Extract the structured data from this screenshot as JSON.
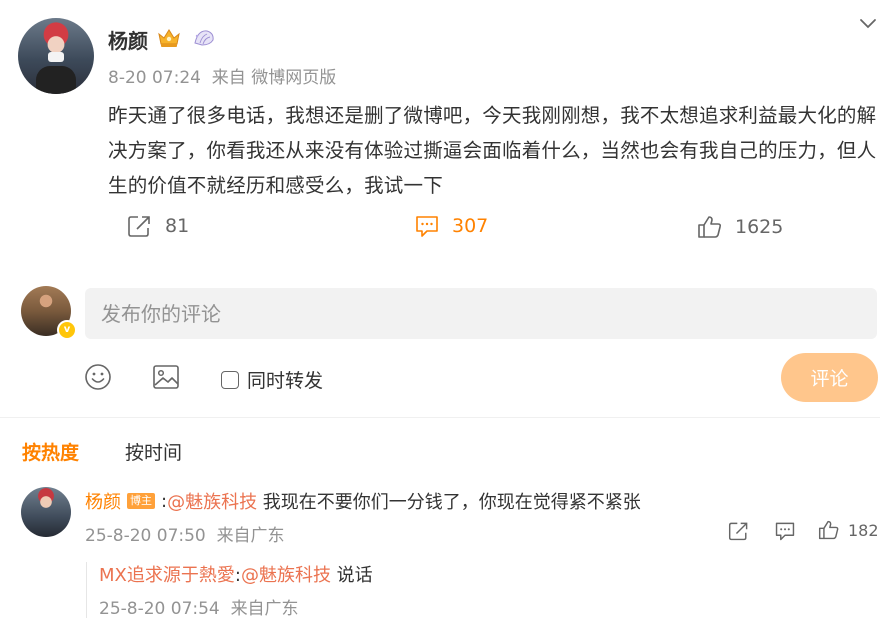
{
  "post": {
    "author": "杨颜",
    "date": "8-20 07:24",
    "source": "来自 微博网页版",
    "text": "昨天通了很多电话，我想还是删了微博吧，今天我刚刚想，我不太想追求利益最大化的解决方案了，你看我还从来没有体验过撕逼会面临着什么，当然也会有我自己的压力，但人生的价值不就经历和感受么，我试一下",
    "reposts": "81",
    "comments": "307",
    "likes": "1625"
  },
  "composer": {
    "placeholder": "发布你的评论",
    "repost_label": "同时转发",
    "submit_label": "评论",
    "verified_mark": "v"
  },
  "sort_tabs": {
    "hot": "按热度",
    "time": "按时间"
  },
  "comment": {
    "author": "杨颜",
    "host_tag": "博主",
    "colon": ":",
    "mention": "@魅族科技",
    "text": " 我现在不要你们一分钱了，你现在觉得紧不紧张",
    "date": "25-8-20 07:50",
    "source": "来自广东",
    "likes": "182"
  },
  "reply": {
    "author": "MX追求源于熱愛",
    "colon": ":",
    "mention": "@魅族科技",
    "text": " 说话",
    "date": "25-8-20 07:54",
    "source": "来自广东"
  },
  "icons": {
    "verified_badge": "gold-crown-icon",
    "fan_badge": "shell-icon",
    "menu": "chevron-down-icon",
    "repost": "share-icon",
    "comment": "comment-icon",
    "like": "thumbs-up-icon",
    "emoji": "smiley-icon",
    "image": "image-icon"
  },
  "colors": {
    "accent": "#ff8200",
    "mention": "#eb7350",
    "submit_disabled": "#ffc68c",
    "meta_gray": "#939393"
  }
}
